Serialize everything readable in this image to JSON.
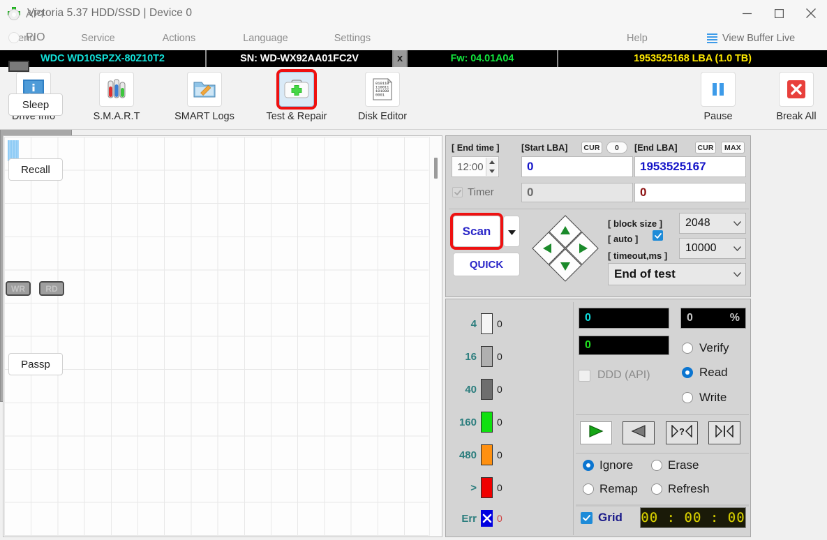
{
  "window": {
    "title": "Victoria 5.37 HDD/SSD | Device 0",
    "app_icon": "green-cross-icon",
    "minimize": "minimize-icon",
    "maximize": "maximize-icon",
    "close": "close-icon"
  },
  "menu": {
    "items": [
      "Menu",
      "Service",
      "Actions",
      "Language",
      "Settings"
    ],
    "help": "Help",
    "view_buffer_live": "View Buffer Live"
  },
  "info_bar": {
    "model": "WDC WD10SPZX-80Z10T2",
    "serial": "SN: WD-WX92AA01FC2V",
    "x_button": "x",
    "firmware": "Fw: 04.01A04",
    "capacity": "1953525168 LBA (1.0 TB)",
    "colors": {
      "model": "#12e0d8",
      "serial": "#ffffff",
      "firmware": "#12e43c",
      "capacity": "#ffe900"
    }
  },
  "toolbar": {
    "buttons": [
      {
        "label": "Drive Info",
        "icon": "info-icon"
      },
      {
        "label": "S.M.A.R.T",
        "icon": "test-tubes-icon"
      },
      {
        "label": "SMART Logs",
        "icon": "folder-pencil-icon"
      },
      {
        "label": "Test & Repair",
        "icon": "first-aid-kit-icon",
        "selected": true
      },
      {
        "label": "Disk Editor",
        "icon": "binary-page-icon"
      }
    ],
    "right_buttons": [
      {
        "label": "Pause",
        "icon": "pause-icon"
      },
      {
        "label": "Break All",
        "icon": "red-x-icon"
      }
    ]
  },
  "scan_controls": {
    "end_time_label": "[ End time ]",
    "end_time_value": "12:00",
    "timer_label": "Timer",
    "timer_checked": true,
    "start_lba_label": "[Start LBA]",
    "start_lba_cur": "CUR",
    "start_lba_zero_btn": "0",
    "start_lba_value": "0",
    "start_lba_second": "0",
    "end_lba_label": "[End LBA]",
    "end_lba_cur": "CUR",
    "end_lba_max": "MAX",
    "end_lba_value": "1953525167",
    "end_lba_second": "0",
    "scan_button": "Scan",
    "quick_button": "QUICK",
    "dropdown_arrow": "chevron-down-icon",
    "nav_pad": {
      "up": "arrow-up-icon",
      "down": "arrow-down-icon",
      "left": "arrow-left-icon",
      "right": "arrow-right-icon"
    },
    "block_size_label": "[ block size ]",
    "block_size_value": "2048",
    "auto_label": "[ auto ]",
    "auto_checked": true,
    "timeout_label": "[ timeout,ms ]",
    "timeout_value": "10000",
    "end_of_test": "End of test"
  },
  "legend": {
    "rows": [
      {
        "threshold": "4",
        "color": "#f2f2f2",
        "count": "0"
      },
      {
        "threshold": "16",
        "color": "#b0b0b0",
        "count": "0"
      },
      {
        "threshold": "40",
        "color": "#6e6e6e",
        "count": "0"
      },
      {
        "threshold": "160",
        "color": "#10e010",
        "count": "0"
      },
      {
        "threshold": "480",
        "color": "#ff9010",
        "count": "0"
      },
      {
        "threshold": ">",
        "color": "#f00000",
        "count": "0"
      },
      {
        "threshold": "Err",
        "color": "#0000e0",
        "count": "0",
        "glyph": "x-mark-icon"
      }
    ]
  },
  "status": {
    "speed_value": "0",
    "percent_value": "0",
    "percent_symbol": "%",
    "blocks_value": "0",
    "ddd_api_label": "DDD (API)",
    "ddd_checked": false,
    "mode_options": [
      "Verify",
      "Read",
      "Write"
    ],
    "mode_selected": "Read",
    "transport_buttons": [
      "play-icon",
      "rewind-icon",
      "step-question-icon",
      "skip-start-icon"
    ],
    "action_options": [
      "Ignore",
      "Erase",
      "Remap",
      "Refresh"
    ],
    "action_selected": "Ignore",
    "grid_label": "Grid",
    "grid_checked": true,
    "clock": "00 : 00 : 00"
  },
  "sidebar": {
    "api_label": "API",
    "pio_label": "PIO",
    "api_selected": true,
    "sleep_button": "Sleep",
    "recall_button": "Recall",
    "wr_button": "WR",
    "rd_button": "RD",
    "passp_button": "Passp"
  }
}
